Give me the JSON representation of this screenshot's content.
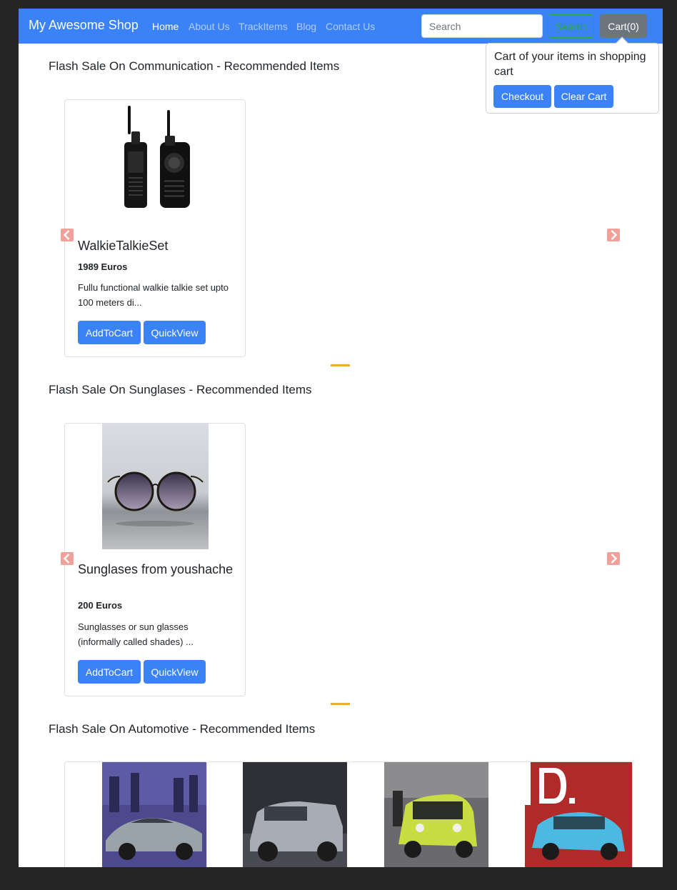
{
  "navbar": {
    "brand": "My Awesome Shop",
    "links": [
      "Home",
      "About Us",
      "TrackItems",
      "Blog",
      "Contact Us"
    ],
    "search_placeholder": "Search",
    "search_button": "Search",
    "cart_button": "Cart(0)"
  },
  "cart_popover": {
    "title": "Cart of your items in shopping cart",
    "checkout": "Checkout",
    "clear": "Clear Cart"
  },
  "sections": [
    {
      "title": "Flash Sale On Communication - Recommended Items",
      "products": [
        {
          "name": "WalkieTalkieSet",
          "price": "1989 Euros",
          "description": "Fullu functional walkie talkie set upto 100 meters di...",
          "add_to_cart": "AddToCart",
          "quick_view": "QuickView"
        }
      ]
    },
    {
      "title": "Flash Sale On Sunglases - Recommended Items",
      "products": [
        {
          "name": "Sunglases from youshache",
          "price": "200 Euros",
          "description": "Sunglasses or sun glasses (informally called shades) ...",
          "add_to_cart": "AddToCart",
          "quick_view": "QuickView"
        }
      ]
    },
    {
      "title": "Flash Sale On Automotive - Recommended Items"
    }
  ],
  "colors": {
    "primary": "#3b82f6",
    "success": "#28a745",
    "secondary": "#6c757d",
    "carousel_arrow": "#f0a19a",
    "carousel_indicator": "#f0a830"
  }
}
